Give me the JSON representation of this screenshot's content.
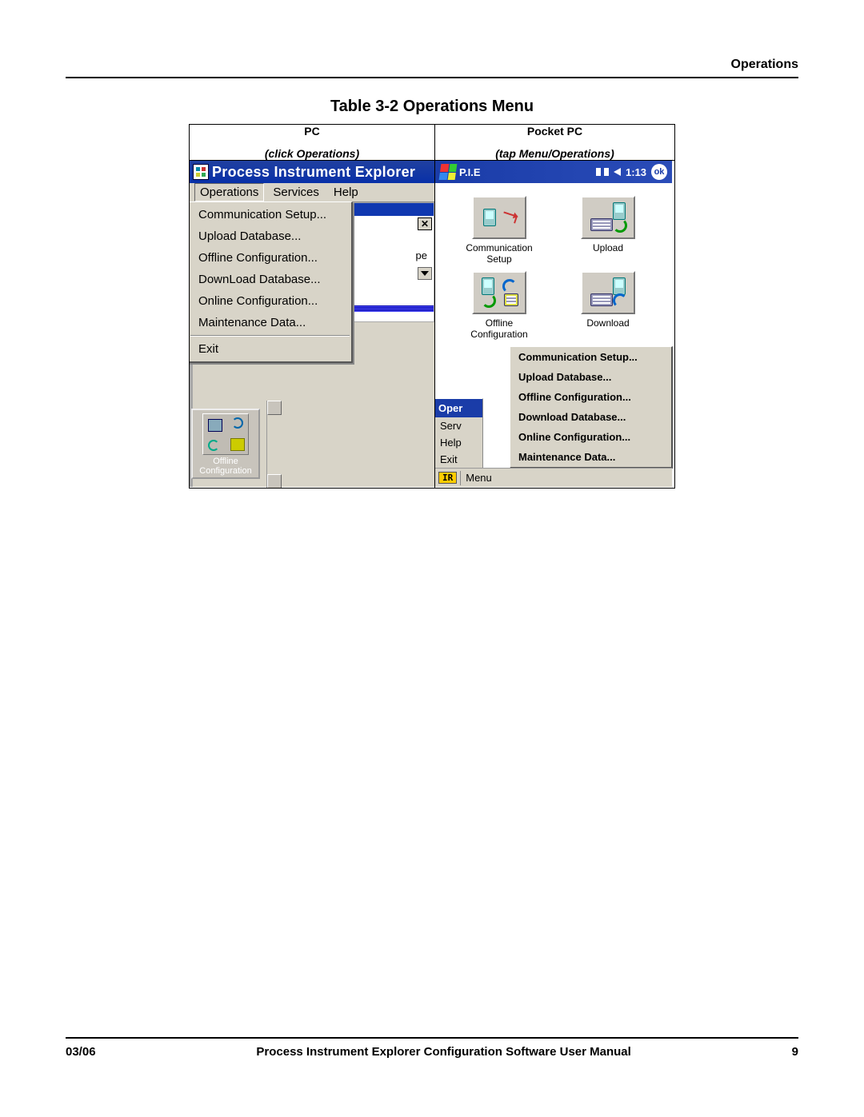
{
  "header": {
    "section": "Operations"
  },
  "table": {
    "title": "Table 3-2 Operations Menu",
    "cols": [
      {
        "name": "PC",
        "sub": "(click Operations)"
      },
      {
        "name": "Pocket PC",
        "sub": "(tap Menu/Operations)"
      }
    ]
  },
  "pc": {
    "title": "Process Instrument Explorer",
    "menubar": [
      "Operations",
      "Services",
      "Help"
    ],
    "sub_pe_text": "pe",
    "dropdown": [
      "Communication Setup...",
      "Upload Database...",
      "Offline Configuration...",
      "DownLoad Database...",
      "Online Configuration...",
      "Maintenance Data..."
    ],
    "exit": "Exit",
    "offline_chip_line1": "Offline",
    "offline_chip_line2": "Configuration"
  },
  "ppc": {
    "title": "P.I.E",
    "time": "1:13",
    "ok": "ok",
    "icons": [
      {
        "label": "Communication Setup"
      },
      {
        "label": "Upload"
      },
      {
        "label": "Offline Configuration"
      },
      {
        "label": "Download"
      }
    ],
    "leftlist_header": "Oper",
    "leftlist": [
      "Serv",
      "Help",
      "Exit"
    ],
    "ir": "IR",
    "menu_label": "Menu",
    "popup": [
      "Communication Setup...",
      "Upload Database...",
      "Offline Configuration...",
      "Download Database...",
      "Online Configuration...",
      "Maintenance Data..."
    ]
  },
  "footer": {
    "left": "03/06",
    "center": "Process Instrument Explorer Configuration Software User Manual",
    "right": "9"
  }
}
